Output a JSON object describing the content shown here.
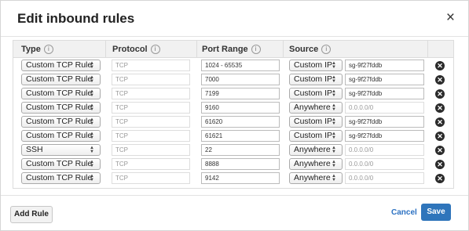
{
  "dialog": {
    "title": "Edit inbound rules",
    "close_label": "×",
    "columns": {
      "type": "Type",
      "protocol": "Protocol",
      "port": "Port Range",
      "source": "Source",
      "info": "i"
    },
    "rows": [
      {
        "type": "Custom TCP Rule",
        "protocol": "TCP",
        "port": "1024 - 65535",
        "source": "Custom IP",
        "cidr": "sg-9f27fddb"
      },
      {
        "type": "Custom TCP Rule",
        "protocol": "TCP",
        "port": "7000",
        "source": "Custom IP",
        "cidr": "sg-9f27fddb"
      },
      {
        "type": "Custom TCP Rule",
        "protocol": "TCP",
        "port": "7199",
        "source": "Custom IP",
        "cidr": "sg-9f27fddb"
      },
      {
        "type": "Custom TCP Rule",
        "protocol": "TCP",
        "port": "9160",
        "source": "Anywhere",
        "cidr": "0.0.0.0/0"
      },
      {
        "type": "Custom TCP Rule",
        "protocol": "TCP",
        "port": "61620",
        "source": "Custom IP",
        "cidr": "sg-9f27fddb"
      },
      {
        "type": "Custom TCP Rule",
        "protocol": "TCP",
        "port": "61621",
        "source": "Custom IP",
        "cidr": "sg-9f27fddb"
      },
      {
        "type": "SSH",
        "protocol": "TCP",
        "port": "22",
        "source": "Anywhere",
        "cidr": "0.0.0.0/0"
      },
      {
        "type": "Custom TCP Rule",
        "protocol": "TCP",
        "port": "8888",
        "source": "Anywhere",
        "cidr": "0.0.0.0/0"
      },
      {
        "type": "Custom TCP Rule",
        "protocol": "TCP",
        "port": "9142",
        "source": "Anywhere",
        "cidr": "0.0.0.0/0"
      }
    ],
    "footer": {
      "add_rule": "Add Rule",
      "cancel": "Cancel",
      "save": "Save"
    }
  }
}
